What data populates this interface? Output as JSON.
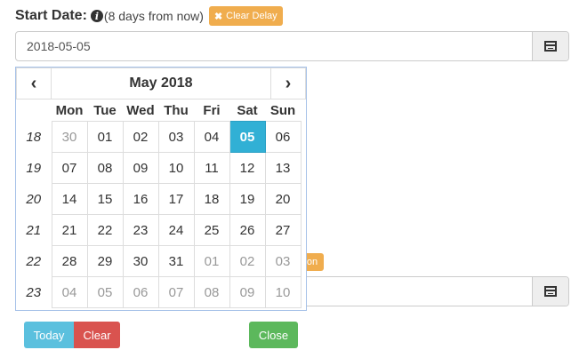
{
  "label": {
    "title": "Start Date:",
    "info_icon": "i",
    "note": "(8 days from now)",
    "clear_delay": "Clear Delay"
  },
  "start_input": {
    "value": "2018-05-05"
  },
  "second_input": {
    "value": "",
    "hidden_button_fragment": "on"
  },
  "calendar": {
    "prev": "‹",
    "next": "›",
    "month": "May 2018",
    "weekdays": [
      "Mon",
      "Tue",
      "Wed",
      "Thu",
      "Fri",
      "Sat",
      "Sun"
    ],
    "weeks": [
      {
        "num": "18",
        "days": [
          {
            "d": "30",
            "muted": true
          },
          {
            "d": "01"
          },
          {
            "d": "02"
          },
          {
            "d": "03"
          },
          {
            "d": "04"
          },
          {
            "d": "05",
            "selected": true
          },
          {
            "d": "06"
          }
        ]
      },
      {
        "num": "19",
        "days": [
          {
            "d": "07"
          },
          {
            "d": "08"
          },
          {
            "d": "09"
          },
          {
            "d": "10"
          },
          {
            "d": "11"
          },
          {
            "d": "12"
          },
          {
            "d": "13"
          }
        ]
      },
      {
        "num": "20",
        "days": [
          {
            "d": "14"
          },
          {
            "d": "15"
          },
          {
            "d": "16"
          },
          {
            "d": "17"
          },
          {
            "d": "18"
          },
          {
            "d": "19"
          },
          {
            "d": "20"
          }
        ]
      },
      {
        "num": "21",
        "days": [
          {
            "d": "21"
          },
          {
            "d": "22"
          },
          {
            "d": "23"
          },
          {
            "d": "24"
          },
          {
            "d": "25"
          },
          {
            "d": "26"
          },
          {
            "d": "27"
          }
        ]
      },
      {
        "num": "22",
        "days": [
          {
            "d": "28"
          },
          {
            "d": "29"
          },
          {
            "d": "30"
          },
          {
            "d": "31"
          },
          {
            "d": "01",
            "muted": true
          },
          {
            "d": "02",
            "muted": true
          },
          {
            "d": "03",
            "muted": true
          }
        ]
      },
      {
        "num": "23",
        "days": [
          {
            "d": "04",
            "muted": true
          },
          {
            "d": "05",
            "muted": true
          },
          {
            "d": "06",
            "muted": true
          },
          {
            "d": "07",
            "muted": true
          },
          {
            "d": "08",
            "muted": true
          },
          {
            "d": "09",
            "muted": true
          },
          {
            "d": "10",
            "muted": true
          }
        ]
      }
    ]
  },
  "footer": {
    "today": "Today",
    "clear": "Clear",
    "close": "Close"
  },
  "colors": {
    "selected": "#31b0d5",
    "today": "#5bc0de",
    "clear": "#d9534f",
    "close": "#5cb85c",
    "warning": "#f0ad4e"
  }
}
